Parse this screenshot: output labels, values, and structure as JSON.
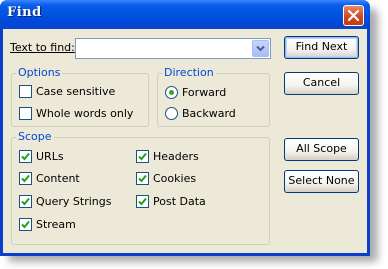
{
  "window": {
    "title": "Find"
  },
  "search": {
    "label": "Text to find:",
    "value": "",
    "placeholder": ""
  },
  "options": {
    "legend": "Options",
    "case_sensitive": {
      "label": "Case sensitive",
      "checked": false
    },
    "whole_words": {
      "label": "Whole words only",
      "checked": false
    }
  },
  "direction": {
    "legend": "Direction",
    "forward": {
      "label": "Forward",
      "selected": true
    },
    "backward": {
      "label": "Backward",
      "selected": false
    }
  },
  "scope": {
    "legend": "Scope",
    "items": [
      {
        "label": "URLs",
        "checked": true
      },
      {
        "label": "Content",
        "checked": true
      },
      {
        "label": "Query Strings",
        "checked": true
      },
      {
        "label": "Stream",
        "checked": true
      },
      {
        "label": "Headers",
        "checked": true
      },
      {
        "label": "Cookies",
        "checked": true
      },
      {
        "label": "Post Data",
        "checked": true
      }
    ]
  },
  "buttons": {
    "find_next": "Find Next",
    "cancel": "Cancel",
    "all_scope": "All Scope",
    "select_none": "Select None"
  },
  "colors": {
    "titlebar": "#0054e3",
    "legend_text": "#0046d5",
    "check_mark": "#21a121",
    "close_button": "#d2471f"
  }
}
